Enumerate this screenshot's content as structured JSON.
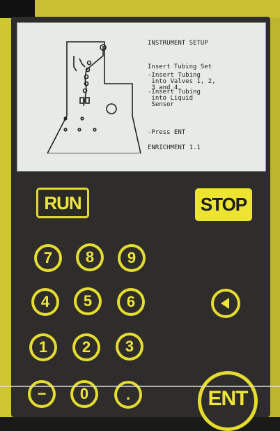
{
  "screen": {
    "title": "INSTRUMENT SETUP",
    "subtitle": "Insert Tubing Set",
    "step1": "-Insert Tubing\n into Valves 1, 2,\n 3 and 4",
    "step2": "-Insert Tubing\n into Liquid\n Sensor",
    "press": "-Press ENT",
    "program": "ENRICHMENT 1.1"
  },
  "keypad": {
    "run": "RUN",
    "stop": "STOP",
    "k7": "7",
    "k8": "8",
    "k9": "9",
    "k4": "4",
    "k5": "5",
    "k6": "6",
    "k1": "1",
    "k2": "2",
    "k3": "3",
    "minus": "−",
    "k0": "0",
    "dot": ".",
    "ent": "ENT",
    "left_icon": "left-arrow-icon"
  },
  "colors": {
    "accent_yellow": "#e6dc30",
    "panel_dark": "#2e2d2b",
    "screen_bg": "#e7ebe6"
  }
}
